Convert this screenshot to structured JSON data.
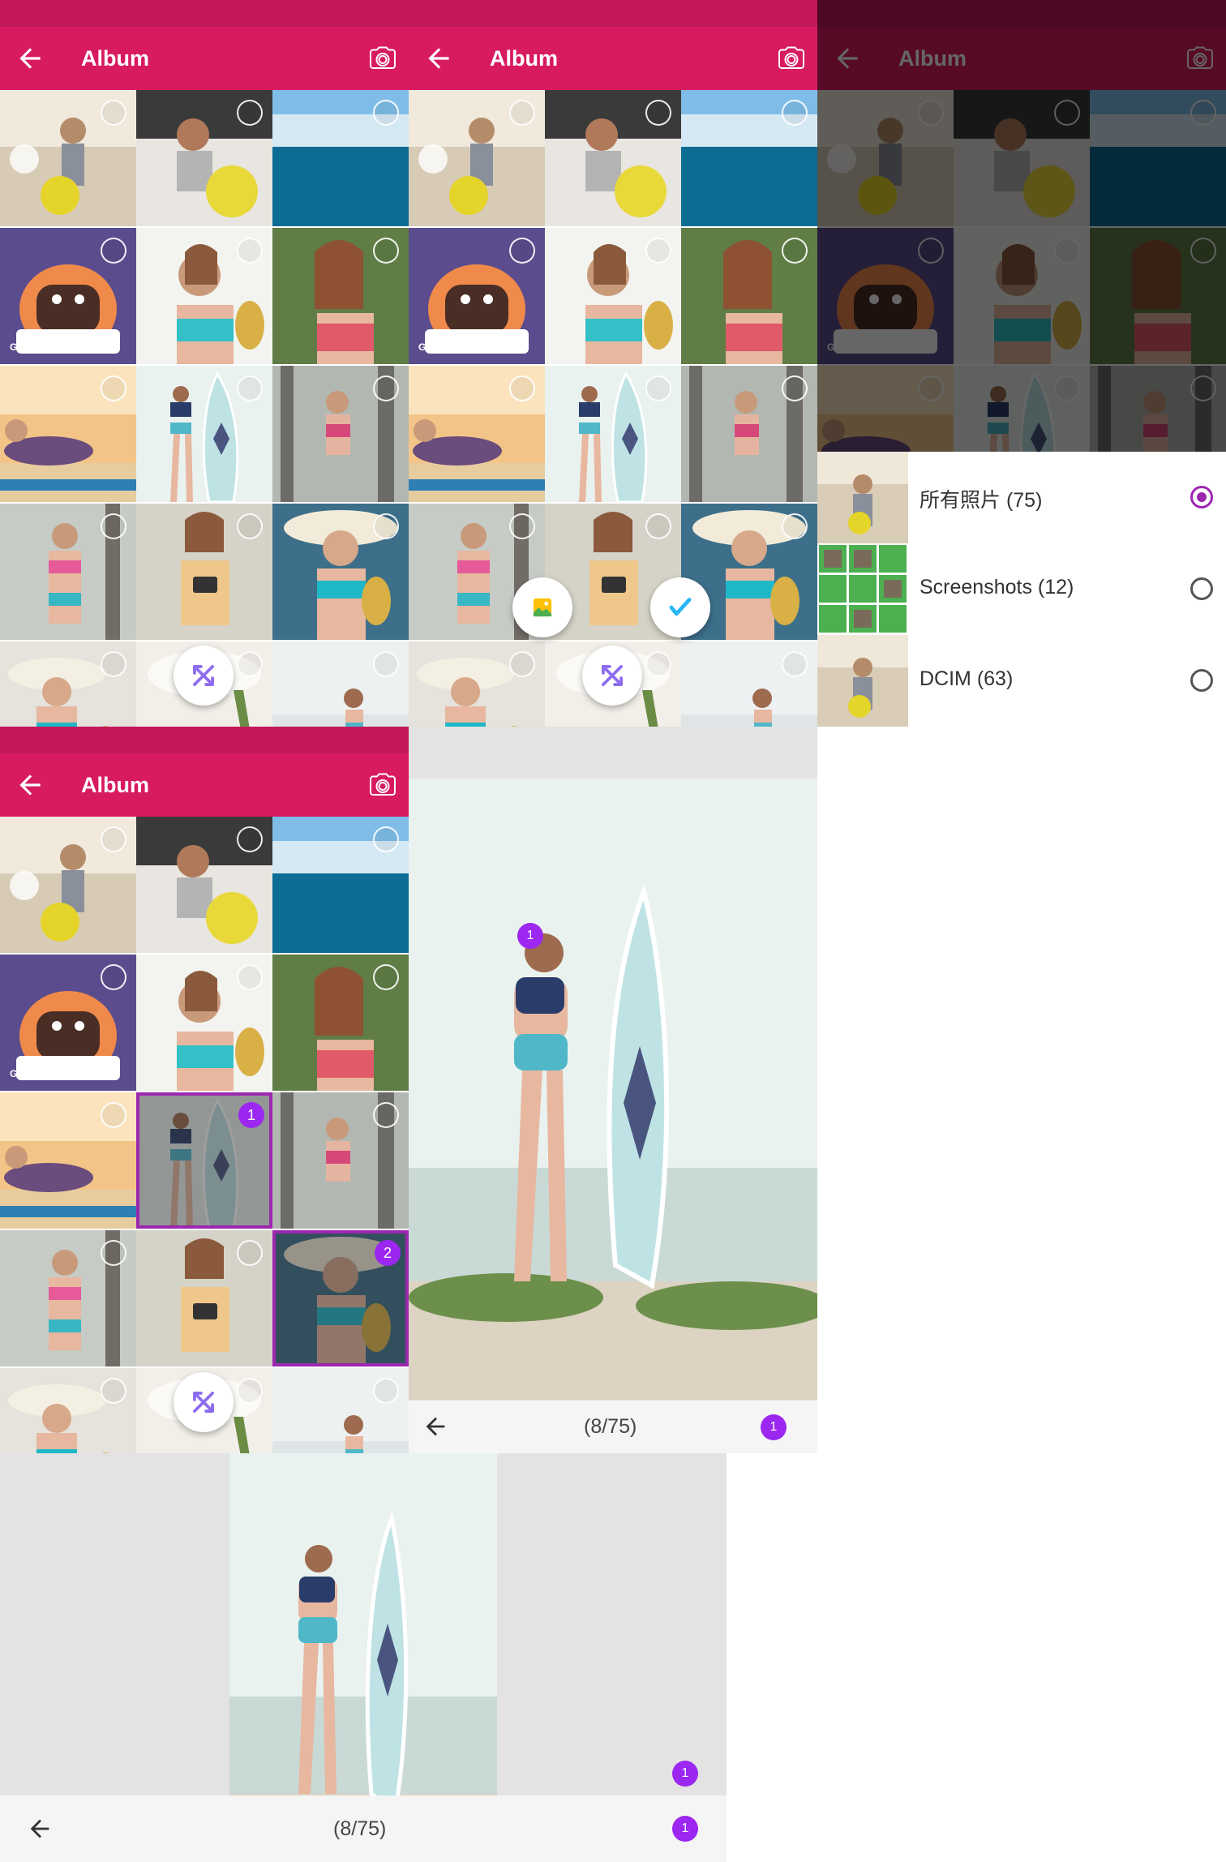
{
  "album": {
    "title": "Album",
    "back_icon": "arrow-left-icon",
    "camera_icon": "camera-icon"
  },
  "colors": {
    "statusbar": "#c2185b",
    "appbar": "#d81b60",
    "accent": "#9c27b0",
    "badge": "#9c27f0"
  },
  "grid": {
    "photos": [
      {
        "kind": "photo-room"
      },
      {
        "kind": "photo-emoji-pillow"
      },
      {
        "kind": "photo-sea"
      },
      {
        "kind": "gif-cartoon",
        "tag": "GIF"
      },
      {
        "kind": "photo-pineapple"
      },
      {
        "kind": "photo-flower"
      },
      {
        "kind": "photo-beach-lying"
      },
      {
        "kind": "photo-surfboard"
      },
      {
        "kind": "photo-trees"
      },
      {
        "kind": "photo-bikini"
      },
      {
        "kind": "photo-camera"
      },
      {
        "kind": "photo-hat-pineapple"
      },
      {
        "kind": "photo-hat"
      },
      {
        "kind": "photo-hat-white"
      },
      {
        "kind": "photo-beach-girl"
      }
    ]
  },
  "selection": {
    "first": "1",
    "second": "2"
  },
  "fabs": {
    "shuffle_icon": "shuffle-icon",
    "gallery_icon": "gallery-icon",
    "confirm_icon": "check-icon"
  },
  "folders": [
    {
      "label": "所有照片 (75)",
      "selected": true
    },
    {
      "label": "Screenshots (12)",
      "selected": false
    },
    {
      "label": "DCIM (63)",
      "selected": false
    }
  ],
  "preview": {
    "counter": "(8/75)",
    "badge": "1"
  }
}
